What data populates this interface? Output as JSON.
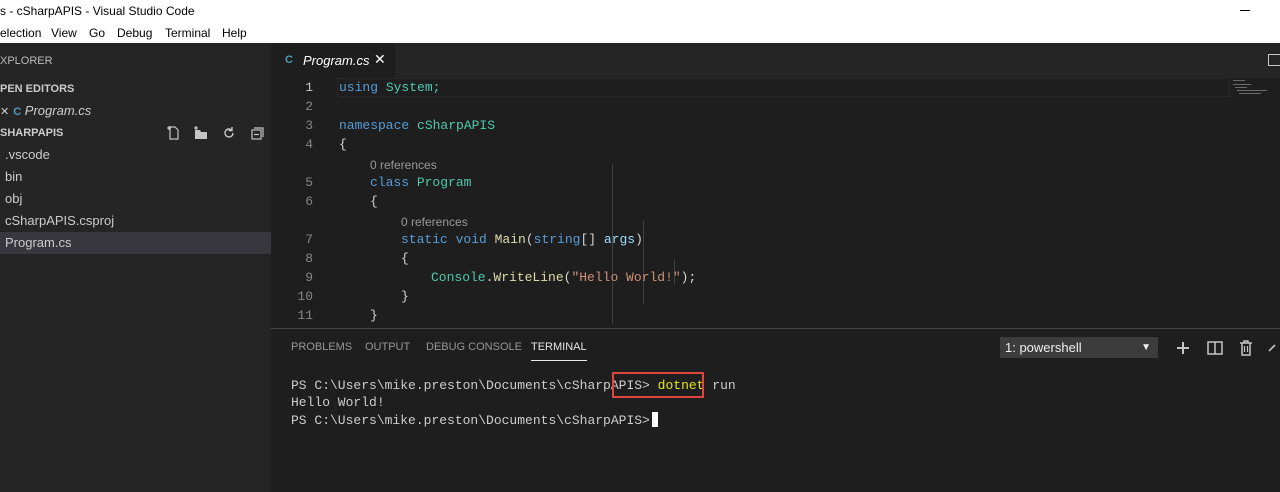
{
  "window": {
    "title": "s - cSharpAPIS - Visual Studio Code"
  },
  "menu": [
    "election",
    "View",
    "Go",
    "Debug",
    "Terminal",
    "Help"
  ],
  "sidebar": {
    "header": "XPLORER",
    "open_editors_label": "PEN EDITORS",
    "open_editor_file": "Program.cs",
    "folder_label": "SHARPAPIS",
    "files": [
      ".vscode",
      "bin",
      "obj",
      "cSharpAPIS.csproj",
      "Program.cs"
    ],
    "selected_file": "Program.cs",
    "cs_icon": "C"
  },
  "editor": {
    "tab_label": "Program.cs",
    "tab_close": "✕",
    "line_numbers": [
      "1",
      "2",
      "3",
      "4",
      "5",
      "6",
      "7",
      "8",
      "9",
      "10",
      "11"
    ],
    "active_line": 1,
    "code": {
      "l1_kw": "using",
      "l1_rest": " System;",
      "l3_kw": "namespace",
      "l3_name": " cSharpAPIS",
      "l4": "{",
      "lens1": "0 references",
      "l5_kw": "class",
      "l5_name": " Program",
      "l6": "{",
      "lens2": "0 references",
      "l7_kw1": "static",
      "l7_kw2": " void",
      "l7_fn": " Main",
      "l7_p1": "(",
      "l7_kw3": "string",
      "l7_p2": "[] ",
      "l7_param": "args",
      "l7_p3": ")",
      "l8": "{",
      "l9_ty": "Console",
      "l9_dot": ".",
      "l9_fn": "WriteLine",
      "l9_p1": "(",
      "l9_str": "\"Hello World!\"",
      "l9_p2": ");",
      "l10": "}",
      "l11": "}"
    }
  },
  "panel": {
    "tabs": [
      "PROBLEMS",
      "OUTPUT",
      "DEBUG CONSOLE",
      "TERMINAL"
    ],
    "active_tab": "TERMINAL",
    "terminal_selector": "1: powershell",
    "selector_arrow": "▼",
    "terminal": {
      "prompt": "PS C:\\Users\\mike.preston\\Documents\\cSharpAPIS>",
      "command": "dotnet",
      "command_arg": " run",
      "output": "Hello World!",
      "prompt2": "PS C:\\Users\\mike.preston\\Documents\\cSharpAPIS>"
    },
    "icons": [
      "plus-icon",
      "split-terminal-icon",
      "trash-icon",
      "chevron-up-icon"
    ]
  },
  "colors": {
    "keyword": "#569cd6",
    "type": "#4ec9b0",
    "function": "#dcdcaa",
    "string": "#ce9178",
    "highlight_box": "#e0463c",
    "terminal_command": "#e5e510"
  }
}
